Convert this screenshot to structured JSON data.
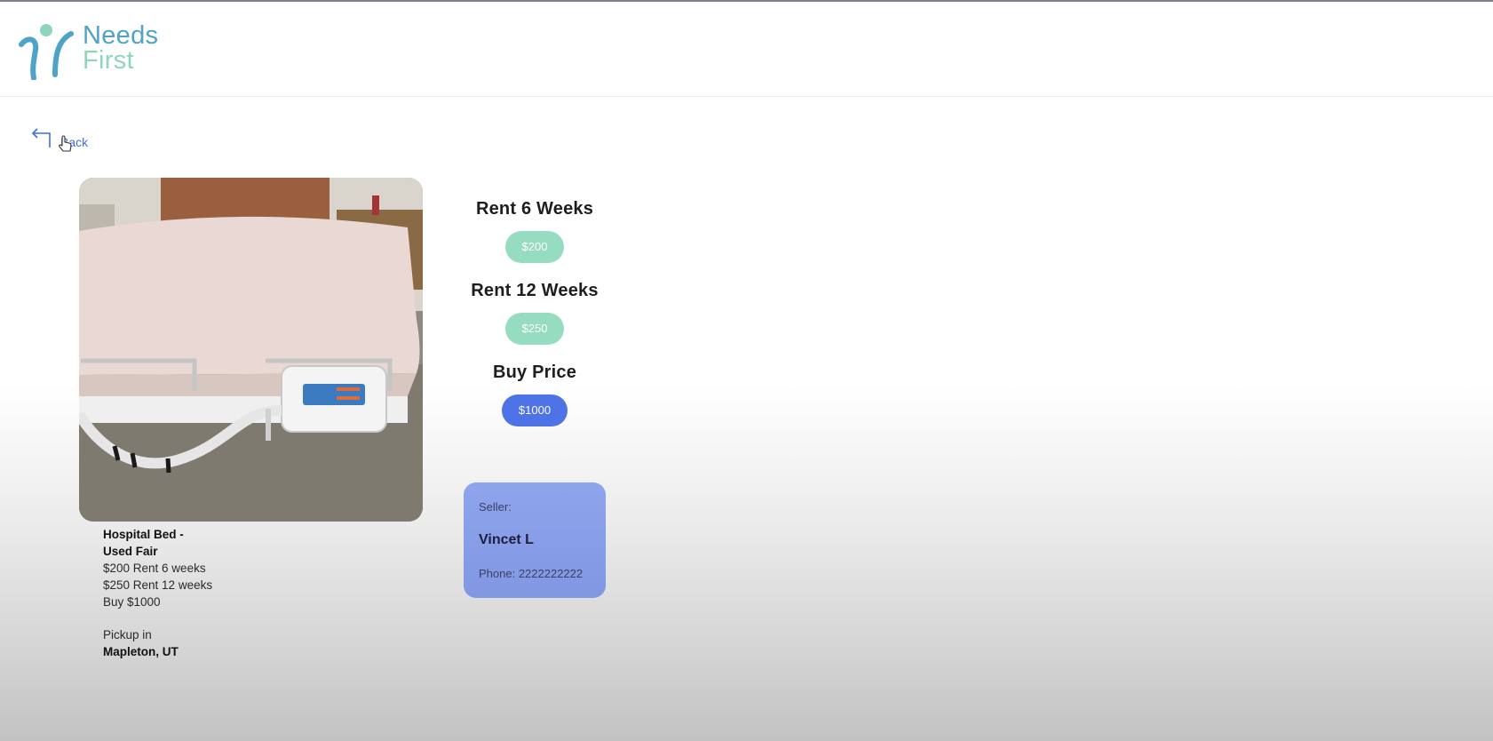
{
  "brand": {
    "line1": "Needs",
    "line2": "First",
    "icon": "needs-first-logo-icon",
    "colors": {
      "primary": "#4ea3c6",
      "secondary": "#8fd5bb"
    }
  },
  "nav": {
    "back_label": "Back",
    "back_icon": "return-arrow-icon",
    "cursor_icon": "hand-pointer-icon"
  },
  "product": {
    "image_icon": "hospital-bed-photo",
    "title_line1": "Hospital Bed -",
    "title_line2": "Used Fair",
    "rent6": "$200 Rent 6 weeks",
    "rent12": "$250 Rent 12 weeks",
    "buy": "Buy $1000",
    "pickup_label": "Pickup in",
    "pickup_location": "Mapleton, UT"
  },
  "pricing": {
    "rent6_title": "Rent 6 Weeks",
    "rent6_price": "$200",
    "rent12_title": "Rent 12 Weeks",
    "rent12_price": "$250",
    "buy_title": "Buy Price",
    "buy_price": "$1000",
    "colors": {
      "rent": "#96dcc0",
      "buy": "#4d73e6"
    }
  },
  "seller": {
    "label": "Seller:",
    "name": "Vincet L",
    "phone": "Phone: 2222222222",
    "color": "#8ea4ec"
  }
}
